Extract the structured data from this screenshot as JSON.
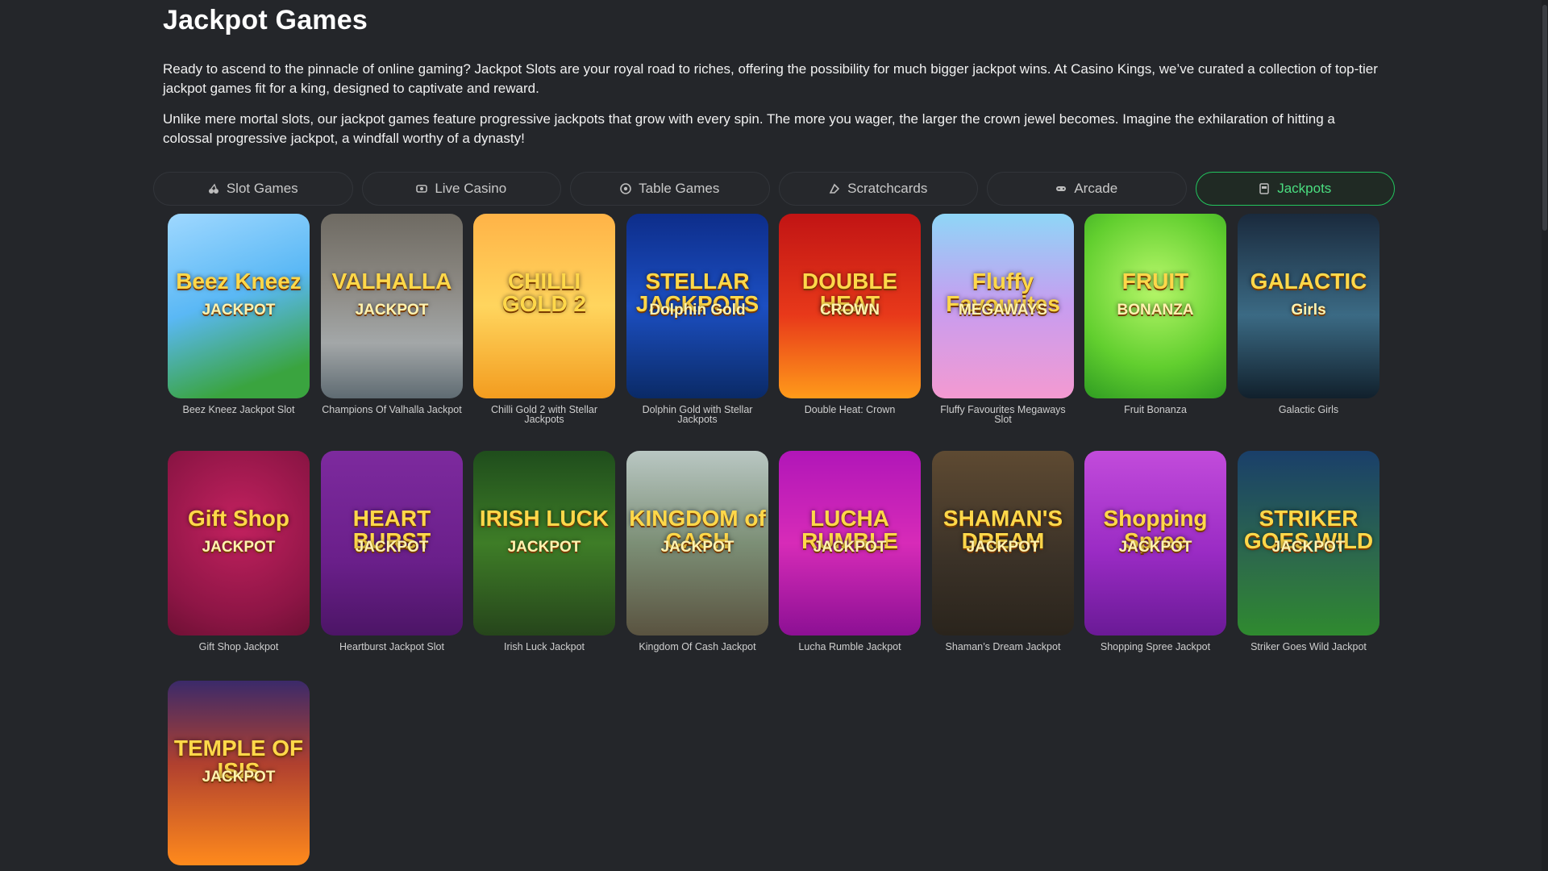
{
  "heading": "Jackpot Games",
  "intro": {
    "p1": "Ready to ascend to the pinnacle of online gaming? Jackpot Slots are your royal road to riches, offering the possibility for much bigger jackpot wins. At Casino Kings, we’ve curated a collection of top-tier jackpot games fit for a king, designed to captivate and reward.",
    "p2": "Unlike mere mortal slots, our jackpot games feature progressive jackpots that grow with every spin. The more you wager, the larger the crown jewel becomes. Imagine the exhilaration of hitting a colossal progressive jackpot, a windfall worthy of a dynasty!"
  },
  "tabs": [
    {
      "label": "Slot Games",
      "icon": "cherries-icon"
    },
    {
      "label": "Live Casino",
      "icon": "chip-icon"
    },
    {
      "label": "Table Games",
      "icon": "roulette-icon"
    },
    {
      "label": "Scratchcards",
      "icon": "scratch-icon"
    },
    {
      "label": "Arcade",
      "icon": "gamepad-icon"
    },
    {
      "label": "Jackpots",
      "icon": "slot-machine-icon",
      "active": true
    }
  ],
  "colors": {
    "accent": "#22c55e",
    "background": "#24262a"
  },
  "games": [
    {
      "caption": "Beez Kneez Jackpot Slot",
      "logo1": "Beez Kneez",
      "logo2": "JACKPOT",
      "bg": "linear-gradient(160deg,#9fd8ff 0%,#5ab8f5 45%,#3aa43f 85%)"
    },
    {
      "caption": "Champions Of Valhalla Jackpot",
      "logo1": "VALHALLA",
      "logo2": "JACKPOT",
      "bg": "linear-gradient(180deg,#6e6a62 0%,#8d8a84 40%,#a3a7a8 70%,#5f6b72 100%)"
    },
    {
      "caption": "Chilli Gold 2 with Stellar Jackpots",
      "logo1": "CHILLI GOLD 2",
      "logo2": "",
      "bg": "linear-gradient(180deg,#ffb347 0%,#ffd55e 50%,#f39c1f 100%)"
    },
    {
      "caption": "Dolphin Gold with Stellar Jackpots",
      "logo1": "STELLAR JACKPOTS",
      "logo2": "Dolphin Gold",
      "bg": "linear-gradient(180deg,#0d2d8a 0%,#1c4fc2 50%,#0a2a66 100%)"
    },
    {
      "caption": "Double Heat: Crown",
      "logo1": "DOUBLE HEAT",
      "logo2": "CROWN",
      "bg": "linear-gradient(180deg,#c11414 0%,#e8391a 55%,#ff9b1a 100%)"
    },
    {
      "caption": "Fluffy Favourites Megaways Slot",
      "logo1": "Fluffy Favourites",
      "logo2": "MEGAWAYS",
      "bg": "linear-gradient(180deg,#8fd6f7 0%,#c79df0 50%,#f49ad1 100%)"
    },
    {
      "caption": "Fruit Bonanza",
      "logo1": "FRUIT",
      "logo2": "BONANZA",
      "bg": "radial-gradient(circle at 50% 40%,#b7f76a 0%,#62cf2f 60%,#2f9c22 100%)"
    },
    {
      "caption": "Galactic Girls",
      "logo1": "GALACTIC",
      "logo2": "Girls",
      "bg": "linear-gradient(180deg,#1a2a3d 0%,#3b6a84 55%,#11202c 100%)"
    },
    {
      "caption": "Gift Shop Jackpot",
      "logo1": "Gift Shop",
      "logo2": "JACKPOT",
      "bg": "radial-gradient(circle at 50% 40%,#c2215f 0%,#8d1545 70%,#6e1034 100%)"
    },
    {
      "caption": "Heartburst Jackpot Slot",
      "logo1": "HEART BURST",
      "logo2": "JACKPOT",
      "bg": "linear-gradient(180deg,#7d2a9e 0%,#6a1f8a 60%,#4c1566 100%)"
    },
    {
      "caption": "Irish Luck Jackpot",
      "logo1": "IRISH LUCK",
      "logo2": "JACKPOT",
      "bg": "linear-gradient(180deg,#1f4d1c 0%,#3e7d27 50%,#26451b 100%)"
    },
    {
      "caption": "Kingdom Of Cash Jackpot",
      "logo1": "KINGDOM of CASH",
      "logo2": "JACKPOT",
      "bg": "linear-gradient(180deg,#b9c7c3 0%,#7c8f76 50%,#5a5340 100%)"
    },
    {
      "caption": "Lucha Rumble Jackpot",
      "logo1": "LUCHA RUMBLE",
      "logo2": "JACKPOT",
      "bg": "linear-gradient(180deg,#b116b8 0%,#d72bb8 50%,#8c1094 100%)"
    },
    {
      "caption": "Shaman’s Dream Jackpot",
      "logo1": "SHAMAN'S DREAM",
      "logo2": "JACKPOT",
      "bg": "linear-gradient(180deg,#5e4a32 0%,#3a3127 60%,#2a241c 100%)"
    },
    {
      "caption": "Shopping Spree Jackpot",
      "logo1": "Shopping Spree",
      "logo2": "JACKPOT",
      "bg": "linear-gradient(180deg,#c24bdb 0%,#9a2bc4 55%,#6a1a96 100%)"
    },
    {
      "caption": "Striker Goes Wild Jackpot",
      "logo1": "STRIKER GOES WILD",
      "logo2": "JACKPOT",
      "bg": "linear-gradient(180deg,#1a3f6a 0%,#2d6b4a 60%,#2f8a2f 100%)"
    },
    {
      "caption": "",
      "logo1": "TEMPLE OF ISIS",
      "logo2": "JACKPOT",
      "bg": "linear-gradient(180deg,#3b2a6a 0%,#b0402f 45%,#ff8a1c 100%)"
    }
  ]
}
